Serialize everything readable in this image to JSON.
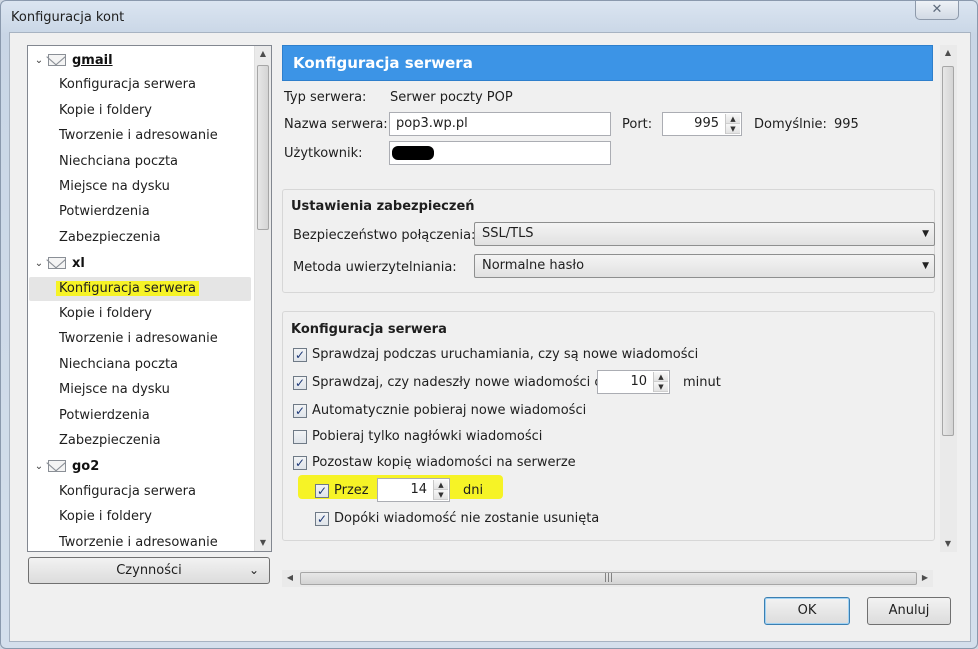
{
  "window": {
    "title": "Konfiguracja kont",
    "close_glyph": "✕"
  },
  "tree": {
    "accounts": [
      {
        "name": "gmail",
        "items": [
          "Konfiguracja serwera",
          "Kopie i foldery",
          "Tworzenie i adresowanie",
          "Niechciana poczta",
          "Miejsce na dysku",
          "Potwierdzenia",
          "Zabezpieczenia"
        ]
      },
      {
        "name": "xl",
        "items": [
          "Konfiguracja serwera",
          "Kopie i foldery",
          "Tworzenie i adresowanie",
          "Niechciana poczta",
          "Miejsce na dysku",
          "Potwierdzenia",
          "Zabezpieczenia"
        ]
      },
      {
        "name": "go2",
        "items": [
          "Konfiguracja serwera",
          "Kopie i foldery",
          "Tworzenie i adresowanie"
        ]
      }
    ],
    "selected": "xl / Konfiguracja serwera"
  },
  "actions_button": "Czynności",
  "panel": {
    "header": "Konfiguracja serwera",
    "server_type_label": "Typ serwera:",
    "server_type_value": "Serwer poczty POP",
    "server_name_label": "Nazwa serwera:",
    "server_name_value": "pop3.wp.pl",
    "port_label": "Port:",
    "port_value": "995",
    "default_label": "Domyślnie:",
    "default_value": "995",
    "user_label": "Użytkownik:"
  },
  "security": {
    "title": "Ustawienia zabezpieczeń",
    "connection_label": "Bezpieczeństwo połączenia:",
    "connection_value": "SSL/TLS",
    "auth_label": "Metoda uwierzytelniania:",
    "auth_value": "Normalne hasło"
  },
  "server_config": {
    "title": "Konfiguracja serwera",
    "check_startup": {
      "label": "Sprawdzaj podczas uruchamiania, czy są nowe wiadomości",
      "checked": true
    },
    "check_every": {
      "label": "Sprawdzaj, czy nadeszły nowe wiadomości co",
      "checked": true,
      "value": "10",
      "unit": "minut"
    },
    "auto_download": {
      "label": "Automatycznie pobieraj nowe wiadomości",
      "checked": true
    },
    "headers_only": {
      "label": "Pobieraj tylko nagłówki wiadomości",
      "checked": false
    },
    "leave_copy": {
      "label": "Pozostaw kopię wiadomości na serwerze",
      "checked": true
    },
    "for_days": {
      "label": "Przez",
      "checked": true,
      "value": "14",
      "unit": "dni"
    },
    "until_deleted": {
      "label": "Dopóki wiadomość nie zostanie usunięta",
      "checked": true
    }
  },
  "buttons": {
    "ok": "OK",
    "cancel": "Anuluj"
  },
  "colors": {
    "header": "#3c94e6",
    "highlight": "#f6f326"
  }
}
